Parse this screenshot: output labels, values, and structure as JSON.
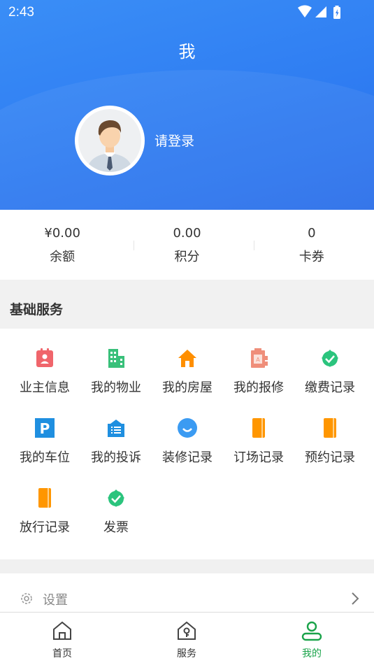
{
  "status_bar": {
    "time": "2:43"
  },
  "header": {
    "title": "我",
    "login_text": "请登录"
  },
  "stats": [
    {
      "value": "¥0.00",
      "label": "余额"
    },
    {
      "value": "0.00",
      "label": "积分"
    },
    {
      "value": "0",
      "label": "卡券"
    }
  ],
  "basic_services": {
    "title": "基础服务",
    "items": [
      {
        "label": "业主信息",
        "icon": "owner-info-icon",
        "color": "#f0656b"
      },
      {
        "label": "我的物业",
        "icon": "building-icon",
        "color": "#39c07a"
      },
      {
        "label": "我的房屋",
        "icon": "house-icon",
        "color": "#ff8f00"
      },
      {
        "label": "我的报修",
        "icon": "repair-icon",
        "color": "#ef8e7a"
      },
      {
        "label": "缴费记录",
        "icon": "payment-icon",
        "color": "#2bc47d"
      },
      {
        "label": "我的车位",
        "icon": "parking-icon",
        "color": "#1f8fe0"
      },
      {
        "label": "我的投诉",
        "icon": "complaint-icon",
        "color": "#1f8fe0"
      },
      {
        "label": "装修记录",
        "icon": "chat-bubble-icon",
        "color": "#3b9bf2"
      },
      {
        "label": "订场记录",
        "icon": "notebook-icon",
        "color": "#ff9600"
      },
      {
        "label": "预约记录",
        "icon": "notebook-icon",
        "color": "#ff9600"
      },
      {
        "label": "放行记录",
        "icon": "notebook-icon",
        "color": "#ff9600"
      },
      {
        "label": "发票",
        "icon": "invoice-icon",
        "color": "#2bc47d"
      }
    ]
  },
  "settings": {
    "label": "设置"
  },
  "tabbar": {
    "tabs": [
      {
        "label": "首页",
        "icon": "home-icon"
      },
      {
        "label": "服务",
        "icon": "service-icon"
      },
      {
        "label": "我的",
        "icon": "profile-icon"
      }
    ],
    "active_color": "#1aa34a"
  }
}
